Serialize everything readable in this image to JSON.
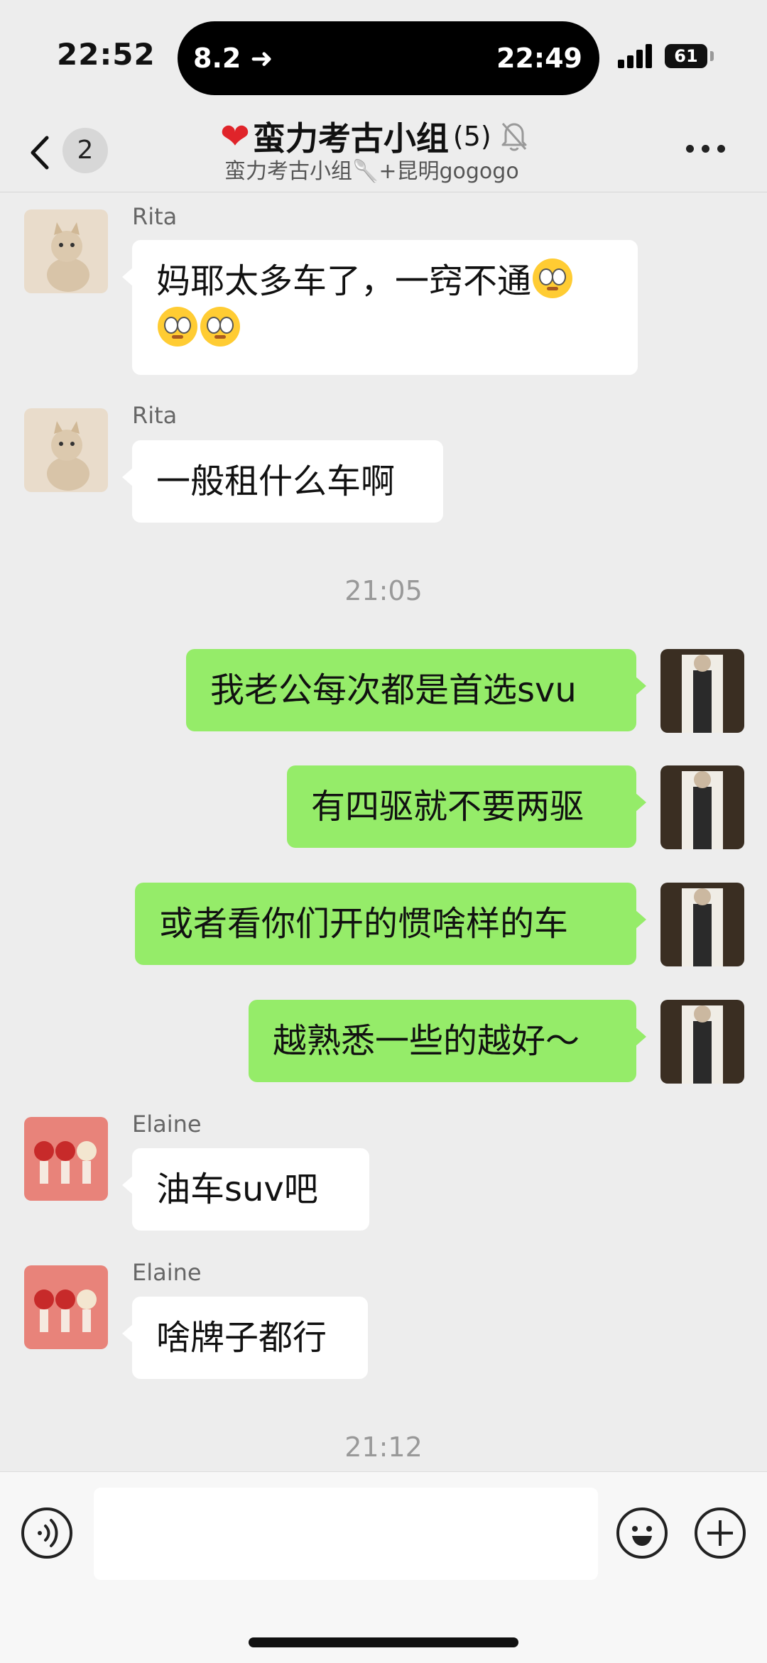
{
  "status_bar": {
    "time": "22:52",
    "island_left": "8.2",
    "island_right": "22:49",
    "battery": "61"
  },
  "header": {
    "back_count": "2",
    "title": "蛮力考古小组",
    "member_count": "(5)",
    "subtitle": "蛮力考古小组🥄+昆明gogogo"
  },
  "messages": [
    {
      "sender": "Rita",
      "text": "妈耶太多车了，一窍不通"
    },
    {
      "sender": "Rita",
      "text": "一般租什么车啊"
    },
    {
      "time": "21:05"
    },
    {
      "text": "我老公每次都是首选svu"
    },
    {
      "text": "有四驱就不要两驱"
    },
    {
      "text": "或者看你们开的惯啥样的车"
    },
    {
      "text": "越熟悉一些的越好～"
    },
    {
      "sender": "Elaine",
      "text": "油车suv吧"
    },
    {
      "sender": "Elaine",
      "text": "啥牌子都行"
    },
    {
      "time": "21:12"
    }
  ],
  "colors": {
    "my_bubble": "#95ec69",
    "background": "#ededed"
  },
  "icons": {
    "back": "chevron-left-icon",
    "mute": "bell-slash-icon",
    "more": "more-dots-icon",
    "voice": "voice-icon",
    "emoji": "emoji-icon",
    "plus": "plus-icon"
  }
}
